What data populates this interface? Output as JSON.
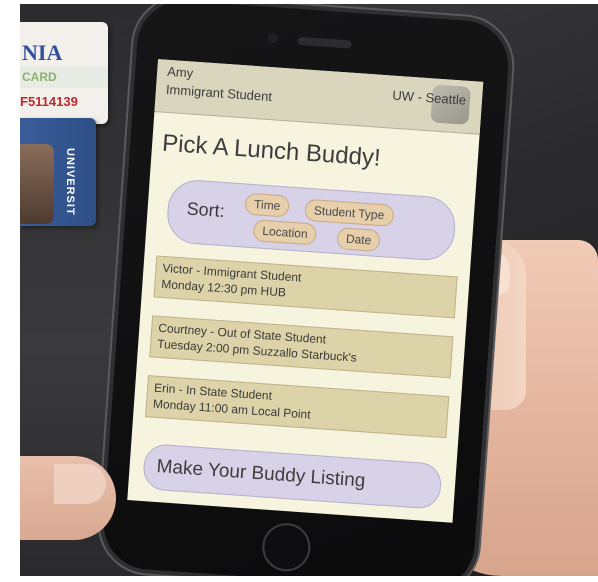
{
  "wallet": {
    "card_brand": "NIA",
    "card_label": "CARD",
    "card_number": "F5114139",
    "uni_card_text": "UNIVERSIT"
  },
  "app": {
    "user_name": "Amy",
    "user_type": "Immigrant Student",
    "school": "UW - Seattle",
    "title": "Pick A Lunch Buddy!",
    "sort": {
      "label": "Sort:",
      "options": [
        "Time",
        "Student Type",
        "Location",
        "Date"
      ]
    },
    "listings": [
      {
        "line1": "Victor - Immigrant Student",
        "line2": "Monday 12:30 pm HUB"
      },
      {
        "line1": "Courtney - Out of State Student",
        "line2": "Tuesday 2:00 pm Suzzallo Starbuck's"
      },
      {
        "line1": "Erin - In State Student",
        "line2": "Monday 11:00 am Local Point"
      }
    ],
    "make_listing_label": "Make Your Buddy Listing"
  },
  "colors": {
    "screen_bg": "#f6f3de",
    "header_bg": "#dad6be",
    "panel_lavender": "#d7d2e8",
    "pill_tan": "#e6cfaa",
    "listing_khaki": "#ddd3a8"
  }
}
